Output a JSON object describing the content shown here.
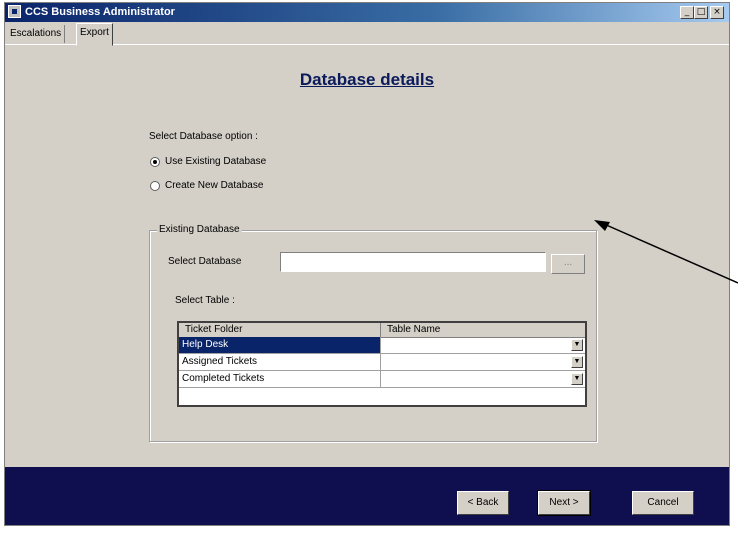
{
  "window": {
    "title": "CCS Business Administrator",
    "minimize_glyph": "_",
    "maximize_glyph": "□",
    "close_glyph": "×"
  },
  "tabs": [
    {
      "label": "Escalations"
    },
    {
      "label": "Export"
    }
  ],
  "page": {
    "heading": "Database details"
  },
  "options": {
    "prompt": "Select Database option :",
    "use_existing": "Use Existing Database",
    "create_new": "Create New Database",
    "selected": "use_existing"
  },
  "existing_database": {
    "group_title": "Existing Database",
    "select_database_label": "Select Database",
    "select_database_value": "",
    "browse_label": "...",
    "select_table_label": "Select Table :"
  },
  "table": {
    "columns": [
      "Ticket Folder",
      "Table Name"
    ],
    "rows": [
      {
        "folder": "Help Desk",
        "table_name": "",
        "selected": true
      },
      {
        "folder": "Assigned Tickets",
        "table_name": ""
      },
      {
        "folder": "Completed Tickets",
        "table_name": ""
      }
    ],
    "dropdown_glyph": "▼"
  },
  "footer": {
    "back_label": "< Back",
    "next_label": "Next >",
    "cancel_label": "Cancel"
  },
  "colors": {
    "window_bg": "#d4d0c8",
    "titlebar": "#0a246a",
    "footer_bg": "#0f0f4f",
    "heading": "#0a1a5a",
    "selection": "#0a246a"
  }
}
